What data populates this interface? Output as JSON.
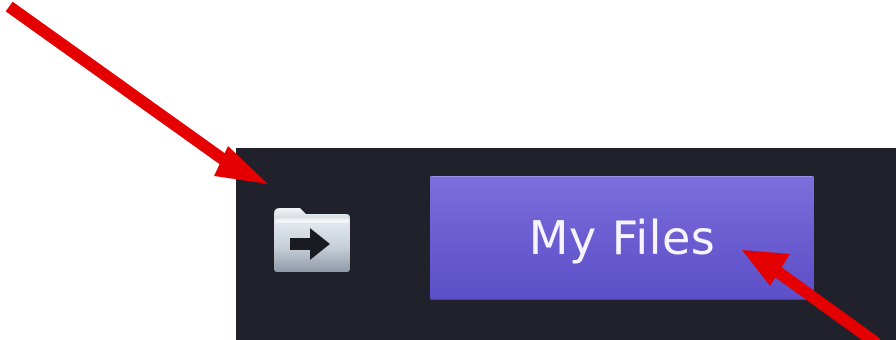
{
  "toolbar": {
    "background_color": "#20212b",
    "folder_icon": "folder-arrow-icon",
    "my_files_label": "My Files",
    "my_files_color": "#6a5bd0"
  },
  "annotations": {
    "arrow_color": "#e40000",
    "arrows": [
      {
        "icon": "red-arrow-icon",
        "target": "folder-arrow-icon"
      },
      {
        "icon": "red-arrow-icon",
        "target": "my-files-button"
      }
    ]
  }
}
